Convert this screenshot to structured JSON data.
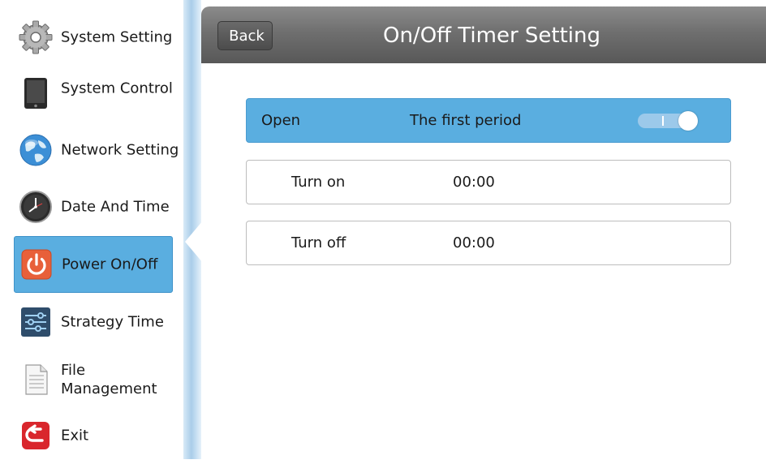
{
  "sidebar": {
    "items": [
      {
        "label": "System Setting",
        "icon": "gear-icon"
      },
      {
        "label": "System Control",
        "icon": "tablet-icon"
      },
      {
        "label": "Network Setting",
        "icon": "globe-icon"
      },
      {
        "label": "Date And Time",
        "icon": "clock-icon"
      },
      {
        "label": "Power On/Off",
        "icon": "power-icon",
        "active": true
      },
      {
        "label": "Strategy Time",
        "icon": "sliders-icon"
      },
      {
        "label": "File\nManagement",
        "icon": "document-icon"
      },
      {
        "label": "Exit",
        "icon": "exit-icon"
      }
    ]
  },
  "header": {
    "back_label": "Back",
    "title": "On/Off Timer Setting"
  },
  "rows": {
    "period": {
      "label": "Open",
      "value": "The first period",
      "toggle_on": true
    },
    "turn_on": {
      "label": "Turn on",
      "value": "00:00"
    },
    "turn_off": {
      "label": "Turn off",
      "value": "00:00"
    }
  },
  "colors": {
    "accent": "#5aaee0",
    "header_gray": "#6f6f6f",
    "power_icon": "#e8603a",
    "exit_icon": "#d9262c"
  }
}
